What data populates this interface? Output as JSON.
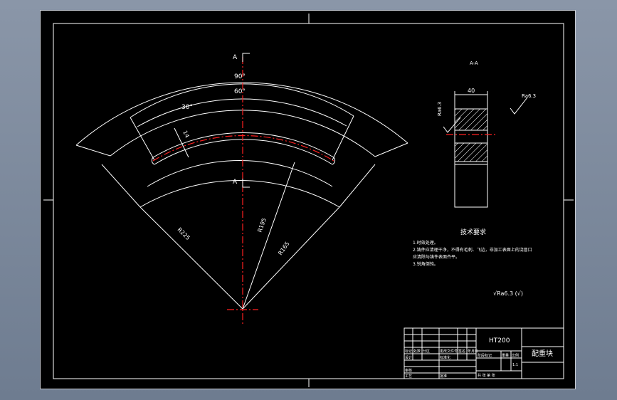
{
  "drawing": {
    "section_marks": [
      "A",
      "A"
    ],
    "angles": [
      "90°",
      "60°",
      "30°"
    ],
    "dims": {
      "slot_width": "14",
      "r_outer": "R225",
      "r_center": "R195",
      "r_inner": "R165"
    },
    "section_view": {
      "title": "A-A",
      "width": "40",
      "roughness_left": "Ra6.3",
      "roughness_right": "Ra6.3"
    }
  },
  "tech_req": {
    "title": "技术要求",
    "lines": [
      "1.时效处理。",
      "2.铸件应清理干净，不得有毛刺、飞边，非加工表面上的浇冒口",
      "应清除与铸件表面齐平。",
      "3.锐角倒钝。"
    ],
    "roughness_general": "√Ra6.3 (√)"
  },
  "title_block": {
    "material": "HT200",
    "part_name": "配重块",
    "row_labels": [
      "标记",
      "处数",
      "分区",
      "更改文件号",
      "签名",
      "年月日"
    ],
    "labels": {
      "design": "设计",
      "std": "标准化",
      "craft": "工艺",
      "approve": "批准",
      "review": "审核"
    },
    "stage": "阶段标记",
    "weight": "重量",
    "scale": "比例",
    "scale_value": "1:1",
    "sheets": "共 张 第 张"
  }
}
